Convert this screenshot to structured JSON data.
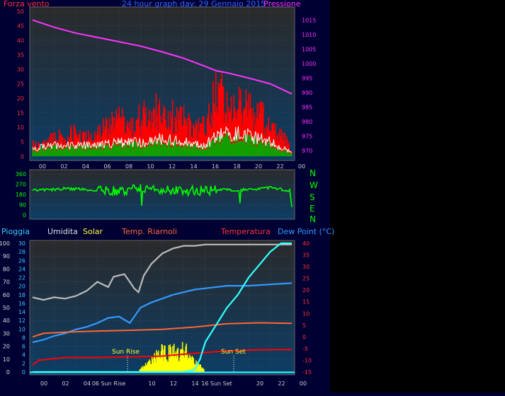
{
  "header": {
    "wind_label": "Forza vento",
    "title": "24 hour graph day:  29 Gennaio 2015",
    "pressure_label": "Pressione"
  },
  "direction_labels": [
    "N",
    "W",
    "S",
    "E",
    "N"
  ],
  "bottom_header": {
    "rain": "Pioggia",
    "humidity": "Umidita",
    "solar": "Solar",
    "temp_shelter": "Temp. Riarnoli",
    "temperature": "Temperatura",
    "dewpoint": "Dew Point (°C)"
  },
  "annotations": {
    "sun_rise": "Sun Rise",
    "sun_set": "Sun Set",
    "sun_rise_tick": "06 Sun Rise",
    "sun_set_tick": "16 Sun Set"
  },
  "colors": {
    "background": "#000033",
    "plot_top": "#2a2a2a",
    "plot_bottom": "#0c3d66",
    "wind_gust": "#ff0000",
    "wind_avg": "#00aa00",
    "wind_line": "#ffffff",
    "pressure": "#ff33ff",
    "direction": "#00ff00",
    "humidity": "#bbbbbb",
    "solar": "#ffff00",
    "temp_shelter": "#ff6633",
    "temperature": "#ff0000",
    "dewpoint": "#3399ff",
    "rain": "#33ffff",
    "left_axis": "#ff3333",
    "direction_axis": "#00ff00"
  },
  "chart_data": [
    {
      "type": "area",
      "name": "wind-pressure",
      "x_ticks": [
        "00",
        "02",
        "04",
        "06",
        "08",
        "10",
        "12",
        "14",
        "16",
        "18",
        "20",
        "22",
        "00"
      ],
      "y_left_ticks": [
        "0",
        "5",
        "10",
        "15",
        "20",
        "25",
        "30",
        "35",
        "40",
        "45",
        "50"
      ],
      "y_right_ticks": [
        "970",
        "975",
        "980",
        "985",
        "990",
        "995",
        "1000",
        "1005",
        "1010",
        "1015"
      ],
      "ylim_left": [
        0,
        50
      ],
      "ylim_right": [
        968,
        1018
      ],
      "pressure": {
        "x": [
          0,
          2,
          4,
          6,
          8,
          10,
          12,
          14,
          16,
          17,
          18,
          20,
          22,
          24
        ],
        "y": [
          1015,
          1012.5,
          1010.5,
          1009,
          1007.5,
          1006,
          1004,
          1001.8,
          999,
          997.5,
          996.8,
          995,
          993,
          989.5
        ]
      },
      "wind_gust_profile": {
        "x": [
          0,
          1,
          2,
          3,
          4,
          5,
          6,
          7,
          8,
          9,
          10,
          11,
          12,
          13,
          14,
          15,
          16,
          17,
          18,
          19,
          20,
          21,
          22,
          23,
          24
        ],
        "y": [
          4,
          5,
          6,
          7,
          8,
          7,
          9,
          11,
          12,
          10,
          13,
          15,
          16,
          14,
          12,
          9,
          10,
          21,
          20,
          18,
          16,
          14,
          11,
          8,
          2
        ]
      },
      "wind_avg_profile": {
        "x": [
          0,
          2,
          4,
          6,
          8,
          10,
          12,
          14,
          16,
          17,
          18,
          20,
          22,
          24
        ],
        "y": [
          2,
          3,
          3,
          3,
          4,
          4,
          5,
          4,
          3,
          6,
          7,
          6,
          4,
          1
        ]
      }
    },
    {
      "type": "line",
      "name": "wind-direction",
      "y_ticks": [
        "0",
        "90",
        "180",
        "270",
        "360"
      ],
      "ylim": [
        0,
        360
      ],
      "x": [
        0,
        1,
        2,
        3,
        4,
        5,
        6,
        7,
        8,
        9,
        10,
        11,
        12,
        13,
        14,
        15,
        16,
        17,
        18,
        19,
        20,
        21,
        22,
        23,
        23.8,
        24
      ],
      "y": [
        215,
        218,
        225,
        232,
        228,
        222,
        218,
        205,
        212,
        220,
        226,
        232,
        222,
        215,
        218,
        212,
        210,
        225,
        222,
        218,
        225,
        232,
        238,
        225,
        215,
        70
      ]
    },
    {
      "type": "line",
      "name": "temp-humidity-solar-rain",
      "x_ticks": [
        "00",
        "02",
        "04",
        "06 Sun Rise",
        "10",
        "12",
        "14",
        "16 Sun Set",
        "20",
        "22",
        "00"
      ],
      "y_left_ticks": [
        "0",
        "10",
        "20",
        "30",
        "40",
        "50",
        "60",
        "70",
        "80",
        "90",
        "100"
      ],
      "y_rain_ticks": [
        "0",
        "2",
        "4",
        "6",
        "8",
        "10",
        "12",
        "14",
        "16",
        "18",
        "20",
        "22",
        "24",
        "26",
        "28",
        "30"
      ],
      "y_right_ticks": [
        "-15",
        "-10",
        "-5",
        "0",
        "5",
        "10",
        "15",
        "20",
        "25",
        "30",
        "35",
        "40"
      ],
      "ylim_left": [
        0,
        100
      ],
      "ylim_right": [
        -15,
        40
      ],
      "humidity": {
        "x": [
          0,
          1,
          2,
          3,
          4,
          5,
          6,
          7,
          7.5,
          8,
          8.5,
          9,
          9.4,
          9.8,
          10.3,
          11,
          12,
          13,
          14,
          15,
          16,
          18,
          20,
          22,
          24
        ],
        "y": [
          58,
          56,
          58,
          57,
          59,
          63,
          70,
          66,
          74,
          75,
          76,
          70,
          65,
          62,
          75,
          84,
          92,
          96,
          98,
          98,
          99,
          99,
          99,
          99,
          99
        ]
      },
      "temp_shelter": {
        "x": [
          0,
          1,
          3,
          6,
          9,
          12,
          15,
          18,
          21,
          24
        ],
        "y": [
          0,
          1.5,
          2,
          2.5,
          2.8,
          3.2,
          4.2,
          5.6,
          6,
          5.8
        ]
      },
      "temperature": {
        "x": [
          0,
          0.6,
          1.5,
          3,
          6,
          9,
          12,
          15,
          18,
          21,
          24
        ],
        "y": [
          -12,
          -10,
          -9.5,
          -8.8,
          -8.8,
          -8.6,
          -8.2,
          -7,
          -6,
          -5.5,
          -5.4
        ]
      },
      "dewpoint": {
        "x": [
          0,
          1,
          2,
          3,
          4,
          5,
          6,
          7,
          8,
          9,
          10,
          11,
          12,
          13,
          14,
          15,
          16,
          18,
          20,
          22,
          24
        ],
        "y": [
          23,
          25,
          28,
          30,
          33,
          35,
          38,
          42,
          43,
          38,
          50,
          54,
          57,
          60,
          62,
          64,
          65,
          67,
          67,
          68,
          69
        ]
      },
      "rain": {
        "x": [
          0,
          8,
          14,
          15,
          15.5,
          16,
          17,
          18,
          19,
          20,
          21,
          22,
          23,
          24
        ],
        "y": [
          0,
          0,
          0,
          0.5,
          3,
          7,
          11,
          15,
          18,
          22,
          25,
          28,
          30,
          30
        ]
      },
      "solar_profile": {
        "x": [
          9,
          9.5,
          10,
          10.5,
          11,
          11.5,
          12,
          12.5,
          13,
          13.5,
          14,
          14.5,
          15
        ],
        "y": [
          2,
          5,
          8,
          12,
          16,
          14,
          18,
          13,
          20,
          14,
          10,
          6,
          1
        ]
      }
    }
  ]
}
